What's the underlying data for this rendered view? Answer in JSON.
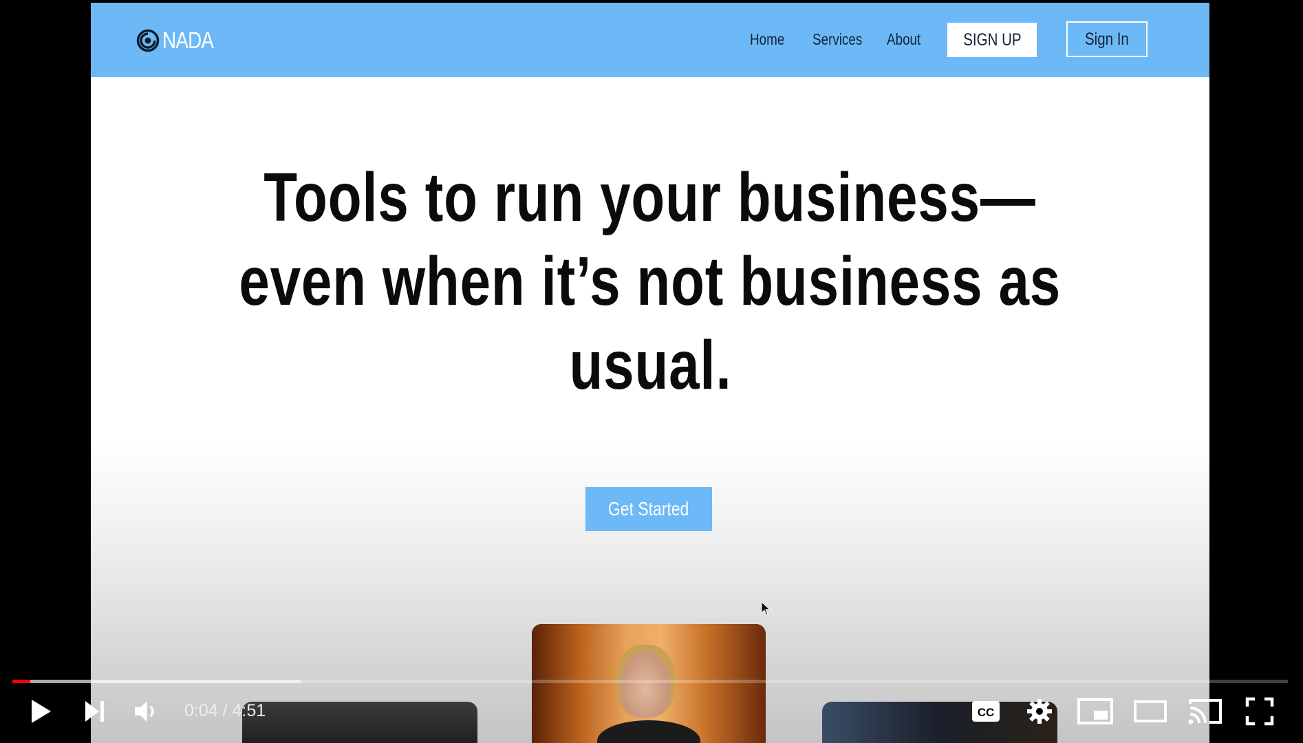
{
  "site": {
    "brand": "NADA",
    "nav": {
      "home": "Home",
      "services": "Services",
      "about": "About"
    },
    "signup": "SIGN UP",
    "signin": "Sign In",
    "hero": [
      "Tools to run your business—",
      "even when it’s not business as",
      "usual."
    ],
    "cta": "Get Started",
    "colors": {
      "nav_bg": "#6db8f6",
      "cta_bg": "#6db8f6"
    }
  },
  "player": {
    "time_current": "0:04",
    "time_separator": " / ",
    "time_total": "4:51",
    "progress_played": 0.014,
    "progress_buffered": 0.226,
    "accent": "#ff0000",
    "icons": [
      "play-icon",
      "next-icon",
      "volume-icon",
      "cc-icon",
      "settings-icon",
      "miniplayer-icon",
      "theater-icon",
      "cast-icon",
      "fullscreen-icon"
    ]
  }
}
